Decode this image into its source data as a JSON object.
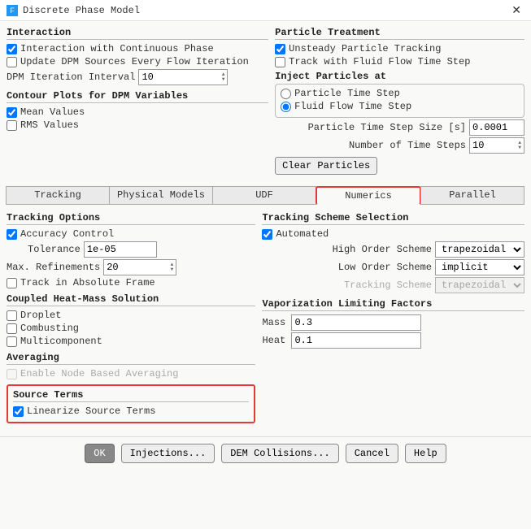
{
  "title": "Discrete Phase Model",
  "interaction": {
    "legend": "Interaction",
    "with_continuous": "Interaction with Continuous Phase",
    "update_dpm": "Update DPM Sources Every Flow Iteration",
    "dpm_interval_label": "DPM Iteration Interval",
    "dpm_interval_value": "10"
  },
  "contour": {
    "legend": "Contour Plots for DPM Variables",
    "mean": "Mean Values",
    "rms": "RMS Values"
  },
  "treatment": {
    "legend": "Particle Treatment",
    "unsteady": "Unsteady Particle Tracking",
    "track_with": "Track with Fluid Flow Time Step",
    "inject_legend": "Inject Particles at",
    "opt_particle": "Particle Time Step",
    "opt_fluid": "Fluid Flow Time Step",
    "step_size_label": "Particle Time Step Size [s]",
    "step_size_value": "0.0001",
    "num_steps_label": "Number of Time Steps",
    "num_steps_value": "10",
    "clear_btn": "Clear Particles"
  },
  "tabs": {
    "tracking": "Tracking",
    "physical": "Physical Models",
    "udf": "UDF",
    "numerics": "Numerics",
    "parallel": "Parallel"
  },
  "tracking_opts": {
    "legend": "Tracking Options",
    "accuracy": "Accuracy Control",
    "tolerance_label": "Tolerance",
    "tolerance_value": "1e-05",
    "max_ref_label": "Max. Refinements",
    "max_ref_value": "20",
    "abs_frame": "Track in Absolute Frame"
  },
  "coupled": {
    "legend": "Coupled Heat-Mass Solution",
    "droplet": "Droplet",
    "combusting": "Combusting",
    "multi": "Multicomponent"
  },
  "averaging": {
    "legend": "Averaging",
    "node": "Enable Node Based Averaging"
  },
  "source": {
    "legend": "Source Terms",
    "linearize": "Linearize Source Terms"
  },
  "scheme": {
    "legend": "Tracking Scheme Selection",
    "automated": "Automated",
    "high_label": "High Order Scheme",
    "high_value": "trapezoidal",
    "low_label": "Low Order Scheme",
    "low_value": "implicit",
    "track_label": "Tracking Scheme",
    "track_value": "trapezoidal"
  },
  "vapor": {
    "legend": "Vaporization Limiting Factors",
    "mass_label": "Mass",
    "mass_value": "0.3",
    "heat_label": "Heat",
    "heat_value": "0.1"
  },
  "footer": {
    "ok": "OK",
    "injections": "Injections...",
    "dem": "DEM Collisions...",
    "cancel": "Cancel",
    "help": "Help"
  }
}
